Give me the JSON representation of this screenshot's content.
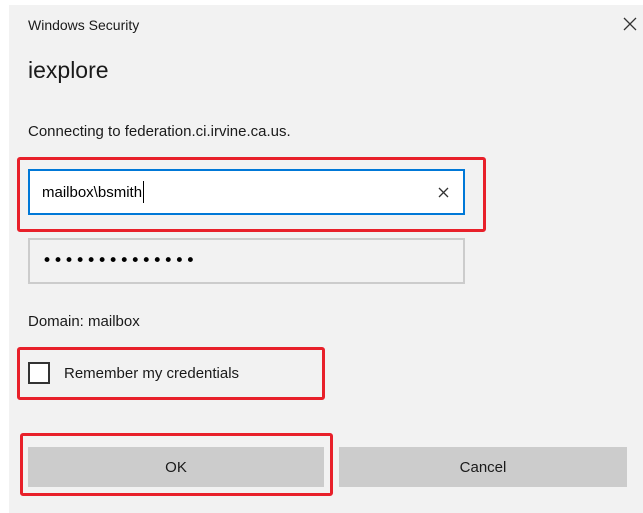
{
  "dialog": {
    "window_title": "Windows Security",
    "app_name": "iexplore",
    "message": "Connecting to federation.ci.irvine.ca.us.",
    "username": {
      "value": "mailbox\\bsmith",
      "clear_icon": "close-icon"
    },
    "password": {
      "masked_value": "••••••••••••••"
    },
    "domain_label": "Domain: mailbox",
    "remember_credentials": {
      "label": "Remember my credentials",
      "checked": false
    },
    "buttons": {
      "ok_label": "OK",
      "cancel_label": "Cancel"
    },
    "close_icon": "close-icon"
  },
  "colors": {
    "dialog_bg": "#f2f2f2",
    "input_focus_border": "#0078d7",
    "button_bg": "#cccccc",
    "annotation_highlight": "#e8202a"
  }
}
